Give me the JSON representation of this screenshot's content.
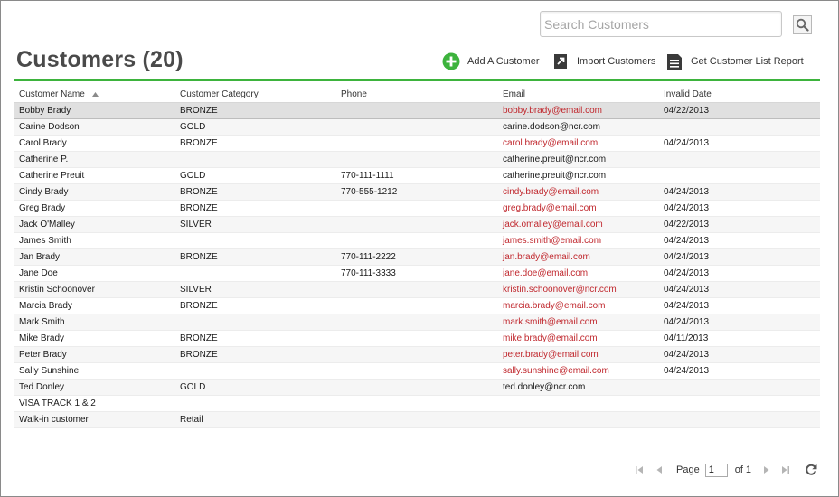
{
  "search": {
    "placeholder": "Search Customers",
    "value": "",
    "button_icon": "search-icon"
  },
  "header": {
    "title": "Customers (20)"
  },
  "toolbar": [
    {
      "label": "Add A Customer",
      "icon": "add-circle-icon",
      "color": "#3db33d"
    },
    {
      "label": "Import Customers",
      "icon": "import-arrow-icon"
    },
    {
      "label": "Get Customer List Report",
      "icon": "report-document-icon"
    }
  ],
  "colors": {
    "accent": "#3db33d",
    "invalid_email": "#c0272d",
    "title": "#4a4a4a"
  },
  "table": {
    "columns": [
      {
        "label": "Customer Name",
        "sorted": "ascending"
      },
      {
        "label": "Customer Category"
      },
      {
        "label": "Phone"
      },
      {
        "label": "Email"
      },
      {
        "label": "Invalid Date"
      }
    ],
    "selected_row": 0,
    "rows": [
      {
        "name": "Bobby Brady",
        "category": "BRONZE",
        "phone": "",
        "email": "bobby.brady@email.com",
        "invalid_date": "04/22/2013"
      },
      {
        "name": "Carine Dodson",
        "category": "GOLD",
        "phone": "",
        "email": "carine.dodson@ncr.com",
        "invalid_date": ""
      },
      {
        "name": "Carol Brady",
        "category": "BRONZE",
        "phone": "",
        "email": "carol.brady@email.com",
        "invalid_date": "04/24/2013"
      },
      {
        "name": "Catherine P.",
        "category": "",
        "phone": "",
        "email": "catherine.preuit@ncr.com",
        "invalid_date": ""
      },
      {
        "name": "Catherine Preuit",
        "category": "GOLD",
        "phone": "770-111-1111",
        "email": "catherine.preuit@ncr.com",
        "invalid_date": ""
      },
      {
        "name": "Cindy Brady",
        "category": "BRONZE",
        "phone": "770-555-1212",
        "email": "cindy.brady@email.com",
        "invalid_date": "04/24/2013"
      },
      {
        "name": "Greg Brady",
        "category": "BRONZE",
        "phone": "",
        "email": "greg.brady@email.com",
        "invalid_date": "04/24/2013"
      },
      {
        "name": "Jack O'Malley",
        "category": "SILVER",
        "phone": "",
        "email": "jack.omalley@email.com",
        "invalid_date": "04/22/2013"
      },
      {
        "name": "James Smith",
        "category": "",
        "phone": "",
        "email": "james.smith@email.com",
        "invalid_date": "04/24/2013"
      },
      {
        "name": "Jan Brady",
        "category": "BRONZE",
        "phone": "770-111-2222",
        "email": "jan.brady@email.com",
        "invalid_date": "04/24/2013"
      },
      {
        "name": "Jane Doe",
        "category": "",
        "phone": "770-111-3333",
        "email": "jane.doe@email.com",
        "invalid_date": "04/24/2013"
      },
      {
        "name": "Kristin Schoonover",
        "category": "SILVER",
        "phone": "",
        "email": "kristin.schoonover@ncr.com",
        "invalid_date": "04/24/2013"
      },
      {
        "name": "Marcia Brady",
        "category": "BRONZE",
        "phone": "",
        "email": "marcia.brady@email.com",
        "invalid_date": "04/24/2013"
      },
      {
        "name": "Mark Smith",
        "category": "",
        "phone": "",
        "email": "mark.smith@email.com",
        "invalid_date": "04/24/2013"
      },
      {
        "name": "Mike Brady",
        "category": "BRONZE",
        "phone": "",
        "email": "mike.brady@email.com",
        "invalid_date": "04/11/2013"
      },
      {
        "name": "Peter Brady",
        "category": "BRONZE",
        "phone": "",
        "email": "peter.brady@email.com",
        "invalid_date": "04/24/2013"
      },
      {
        "name": "Sally Sunshine",
        "category": "",
        "phone": "",
        "email": "sally.sunshine@email.com",
        "invalid_date": "04/24/2013"
      },
      {
        "name": "Ted Donley",
        "category": "GOLD",
        "phone": "",
        "email": "ted.donley@ncr.com",
        "invalid_date": ""
      },
      {
        "name": "VISA TRACK 1 & 2",
        "category": "",
        "phone": "",
        "email": "",
        "invalid_date": ""
      },
      {
        "name": "Walk-in customer",
        "category": "Retail",
        "phone": "",
        "email": "",
        "invalid_date": ""
      }
    ]
  },
  "pager": {
    "page_label": "Page",
    "current_page": "1",
    "of_label": "of 1"
  }
}
